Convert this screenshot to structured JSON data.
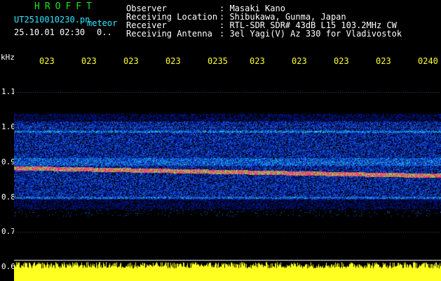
{
  "header": {
    "app_name": "HROFFT",
    "filename": "UT2510010230.pn",
    "filename_suffix": "meteor",
    "datetime": "25.10.01 02:30",
    "count": "0.."
  },
  "info": [
    {
      "label": "Observer",
      "value": ": Masaki Kano"
    },
    {
      "label": "Receiving Location",
      "value": ": Shibukawa, Gunma, Japan"
    },
    {
      "label": "Receiver",
      "value": ": RTL-SDR SDR# 43dB L15 103.2MHz CW"
    },
    {
      "label": "Receiving Antenna",
      "value": ": 3el Yagi(V) Az 330 for Vladivostok"
    }
  ],
  "time_ticks": [
    "023",
    "023",
    "023",
    "023",
    "0235",
    "023",
    "023",
    "023",
    "023",
    "0240"
  ],
  "freq_axis": {
    "unit": "kHz",
    "labels": [
      "1.1",
      "1.0",
      "0.9",
      "0.8",
      "0.7",
      "0.6"
    ]
  },
  "colors": {
    "cyan": "#33e6ff",
    "white": "#ffffff",
    "yellow": "#ffff33",
    "green": "#19e619",
    "signal": "#ff2a80"
  }
}
